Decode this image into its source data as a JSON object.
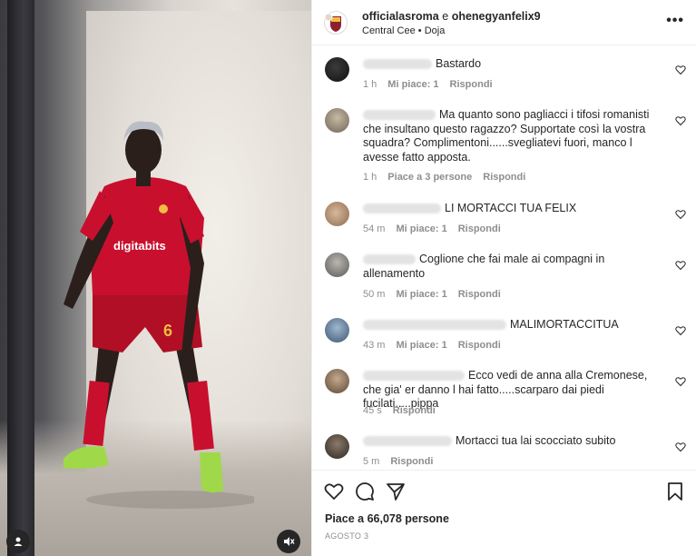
{
  "post": {
    "accounts": "officialasroma",
    "joiner": "e",
    "coauthor": "ohenegyanfelix9",
    "song_artist": "Central Cee",
    "song_separator": "•",
    "song_title": "Doja",
    "more_label": "•••",
    "likes_label": "Piace a 66,078 persone",
    "date_label": "AGOSTO 3"
  },
  "media": {
    "jersey_text": "digitabits",
    "user_tag_icon": "user-icon",
    "mute_icon": "speaker-muted-icon"
  },
  "comments": [
    {
      "username_hidden": true,
      "text": "Bastardo",
      "time": "1 h",
      "likes": "Mi piace: 1",
      "reply": "Rispondi"
    },
    {
      "username_hidden": true,
      "text": "Ma quanto sono pagliacci i tifosi romanisti che insultano questo ragazzo? Supportate così la vostra squadra? Complimentoni......svegliatevi fuori, manco l avesse fatto apposta.",
      "time": "1 h",
      "likes": "Piace a 3 persone",
      "reply": "Rispondi"
    },
    {
      "username_hidden": true,
      "text": "LI MORTACCI TUA FELIX",
      "time": "54 m",
      "likes": "Mi piace: 1",
      "reply": "Rispondi"
    },
    {
      "username_hidden": true,
      "text": "Coglione che fai male ai compagni in allenamento",
      "time": "50 m",
      "likes": "Mi piace: 1",
      "reply": "Rispondi"
    },
    {
      "username_hidden": true,
      "text": "MALIMORTACCITUA",
      "time": "43 m",
      "likes": "Mi piace: 1",
      "reply": "Rispondi"
    },
    {
      "username_hidden": true,
      "text": "Ecco vedi de anna alla Cremonese, che gia' er danno l hai fatto.....scarparo dai piedi fucilati.....pippa",
      "time": "45 s",
      "likes": "",
      "reply": "Rispondi"
    },
    {
      "username_hidden": true,
      "text": "Mortacci tua lai scocciato subito",
      "time": "5 m",
      "likes": "",
      "reply": "Rispondi"
    }
  ],
  "actions": {
    "like_icon": "heart-icon",
    "comment_icon": "comment-icon",
    "share_icon": "paper-plane-icon",
    "save_icon": "bookmark-icon"
  },
  "colors": {
    "text": "#262626",
    "secondary": "#8e8e8e",
    "jersey": "#c8102e",
    "roma_gold": "#f0bc42"
  }
}
